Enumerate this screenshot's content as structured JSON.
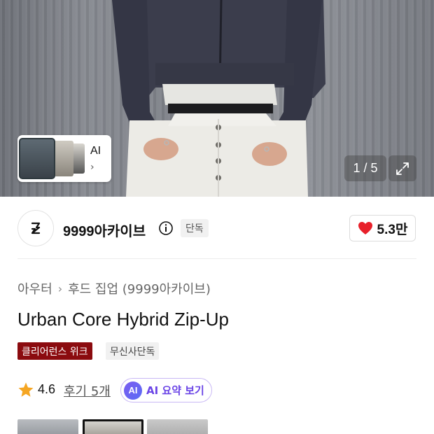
{
  "hero": {
    "ai_thumb_label": "AI",
    "counter": "1 / 5"
  },
  "brand": {
    "name": "9999아카이브",
    "exclusive_badge": "단독",
    "like_count": "5.3만"
  },
  "breadcrumb": {
    "category": "아우터",
    "subcategory": "후드 집업 (9999아카이브)"
  },
  "product": {
    "title": "Urban Core Hybrid Zip-Up",
    "tags": [
      "클리어런스 위크",
      "무신사단독"
    ]
  },
  "review": {
    "rating": "4.6",
    "reviews_label": "후기 5개",
    "ai_summary_icon": "AI",
    "ai_summary_label": "AI 요약 보기"
  },
  "colors": {
    "like_heart": "#e8202a",
    "clearance_tag": "#8b0b0f",
    "star": "#f5a623",
    "ai_accent": "#6a44e6"
  }
}
